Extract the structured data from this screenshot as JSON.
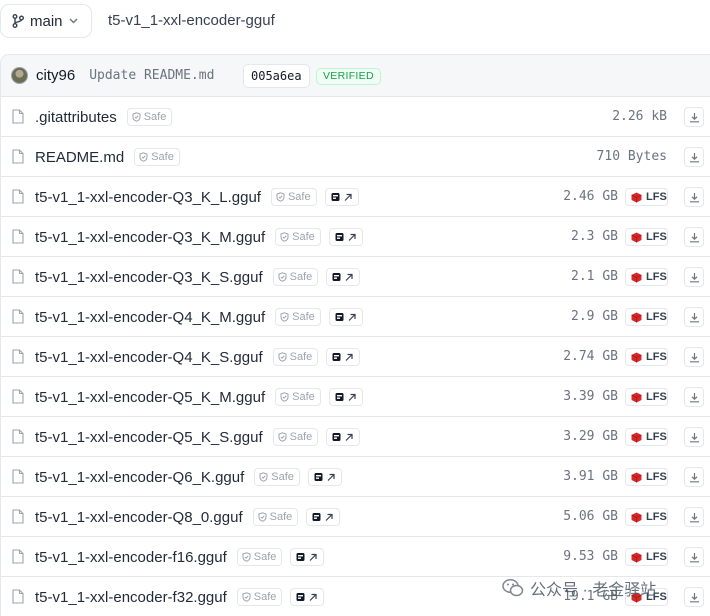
{
  "branch": {
    "label": "main"
  },
  "repo_path": "t5-v1_1-xxl-encoder-gguf",
  "commit": {
    "author": "city96",
    "message": "Update README.md",
    "hash": "005a6ea",
    "status": "VERIFIED"
  },
  "badges": {
    "safe": "Safe",
    "lfs": "LFS"
  },
  "files": [
    {
      "name": ".gitattributes",
      "size": "2.26 kB",
      "lfs": false,
      "external": false
    },
    {
      "name": "README.md",
      "size": "710 Bytes",
      "lfs": false,
      "external": false
    },
    {
      "name": "t5-v1_1-xxl-encoder-Q3_K_L.gguf",
      "size": "2.46 GB",
      "lfs": true,
      "external": true
    },
    {
      "name": "t5-v1_1-xxl-encoder-Q3_K_M.gguf",
      "size": "2.3 GB",
      "lfs": true,
      "external": true
    },
    {
      "name": "t5-v1_1-xxl-encoder-Q3_K_S.gguf",
      "size": "2.1 GB",
      "lfs": true,
      "external": true
    },
    {
      "name": "t5-v1_1-xxl-encoder-Q4_K_M.gguf",
      "size": "2.9 GB",
      "lfs": true,
      "external": true
    },
    {
      "name": "t5-v1_1-xxl-encoder-Q4_K_S.gguf",
      "size": "2.74 GB",
      "lfs": true,
      "external": true
    },
    {
      "name": "t5-v1_1-xxl-encoder-Q5_K_M.gguf",
      "size": "3.39 GB",
      "lfs": true,
      "external": true
    },
    {
      "name": "t5-v1_1-xxl-encoder-Q5_K_S.gguf",
      "size": "3.29 GB",
      "lfs": true,
      "external": true
    },
    {
      "name": "t5-v1_1-xxl-encoder-Q6_K.gguf",
      "size": "3.91 GB",
      "lfs": true,
      "external": true
    },
    {
      "name": "t5-v1_1-xxl-encoder-Q8_0.gguf",
      "size": "5.06 GB",
      "lfs": true,
      "external": true
    },
    {
      "name": "t5-v1_1-xxl-encoder-f16.gguf",
      "size": "9.53 GB",
      "lfs": true,
      "external": true
    },
    {
      "name": "t5-v1_1-xxl-encoder-f32.gguf",
      "size": "19.1 GB",
      "lfs": true,
      "external": true
    }
  ],
  "watermark": "公众号 · 老金驿站",
  "colors": {
    "lfs_red": "#dc2626",
    "verified_green": "#16a34a",
    "border": "#e5e7eb"
  }
}
